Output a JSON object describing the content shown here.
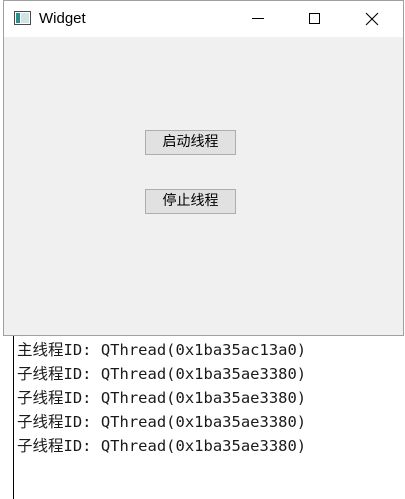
{
  "window": {
    "title": "Widget",
    "controls": {
      "minimize": "minimize",
      "maximize": "maximize",
      "close": "close"
    }
  },
  "buttons": {
    "start_label": "启动线程",
    "stop_label": "停止线程"
  },
  "console": {
    "lines": [
      {
        "prefix": "主线程",
        "text": "ID: QThread(0x1ba35ac13a0)"
      },
      {
        "prefix": "子线程",
        "text": "ID: QThread(0x1ba35ae3380)"
      },
      {
        "prefix": "子线程",
        "text": "ID: QThread(0x1ba35ae3380)"
      },
      {
        "prefix": "子线程",
        "text": "ID: QThread(0x1ba35ae3380)"
      },
      {
        "prefix": "子线程",
        "text": "ID: QThread(0x1ba35ae3380)"
      }
    ]
  },
  "colors": {
    "window_bg": "#f0f0f0",
    "titlebar_bg": "#ffffff",
    "button_bg": "#e1e1e1",
    "button_border": "#adadad",
    "console_text": "#1a1a1a"
  },
  "icons": {
    "app": "qt-widget-app-icon",
    "minimize": "minimize-icon",
    "maximize": "maximize-icon",
    "close": "close-icon"
  }
}
